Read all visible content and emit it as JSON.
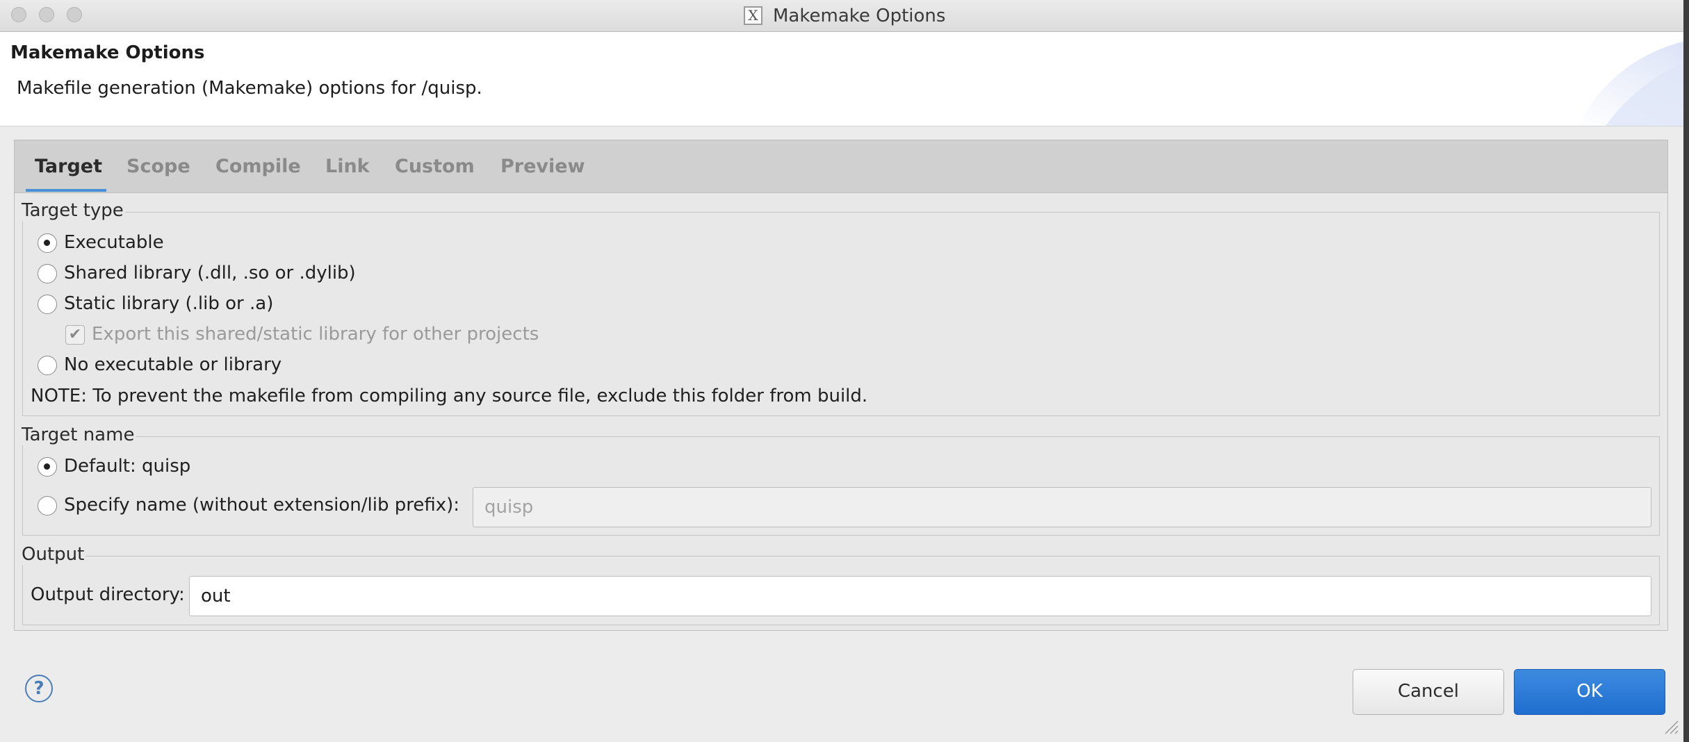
{
  "window": {
    "title": "Makemake Options"
  },
  "header": {
    "title": "Makemake Options",
    "description": "Makefile generation (Makemake) options for /quisp."
  },
  "tabs": [
    {
      "label": "Target",
      "active": true
    },
    {
      "label": "Scope",
      "active": false
    },
    {
      "label": "Compile",
      "active": false
    },
    {
      "label": "Link",
      "active": false
    },
    {
      "label": "Custom",
      "active": false
    },
    {
      "label": "Preview",
      "active": false
    }
  ],
  "target_type": {
    "label": "Target type",
    "options": [
      {
        "label": "Executable",
        "selected": true
      },
      {
        "label": "Shared library (.dll, .so or .dylib)",
        "selected": false
      },
      {
        "label": "Static library (.lib or .a)",
        "selected": false
      },
      {
        "label": "No executable or library",
        "selected": false
      }
    ],
    "export_checkbox": {
      "label": "Export this shared/static library for other projects",
      "checked": true,
      "enabled": false
    },
    "note": "NOTE: To prevent the makefile from compiling any source file, exclude this folder from build."
  },
  "target_name": {
    "label": "Target name",
    "default_option": {
      "label": "Default: quisp",
      "selected": true
    },
    "specify_option": {
      "label": "Specify name (without extension/lib prefix):",
      "selected": false
    },
    "name_field_value": "quisp"
  },
  "output": {
    "label": "Output",
    "dir_label": "Output directory:",
    "dir_value": "out"
  },
  "buttons": {
    "cancel": "Cancel",
    "ok": "OK"
  },
  "colors": {
    "accent": "#4a90d9",
    "ok_button": "#2575d6"
  },
  "icons": [
    "close-dot-icon",
    "minimize-dot-icon",
    "zoom-dot-icon",
    "x11-icon",
    "help-icon",
    "resize-grip-icon"
  ]
}
